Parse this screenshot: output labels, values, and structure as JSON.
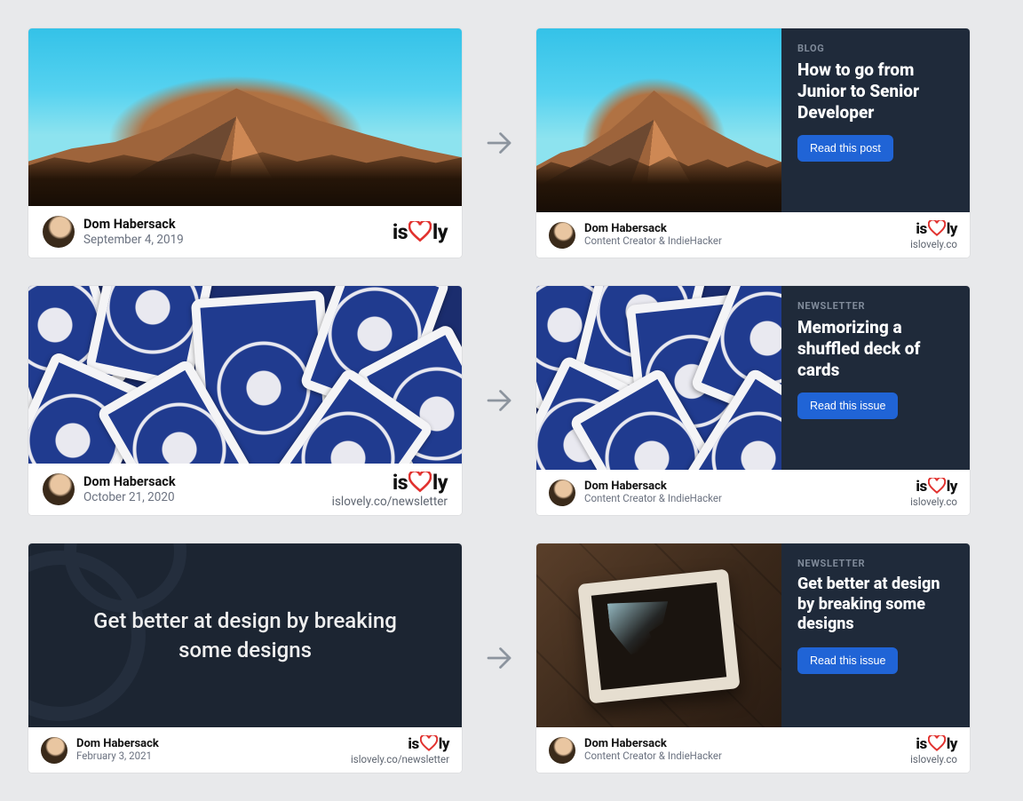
{
  "author": {
    "name": "Dom Habersack",
    "role": "Content Creator & IndieHacker"
  },
  "brand": {
    "prefix": "is",
    "suffix": "ly"
  },
  "site": "islovely.co",
  "rows": [
    {
      "left_sub": "September 4, 2019",
      "left_right_sub": "",
      "eyebrow": "BLOG",
      "title": "How to go from Junior to Senior Developer",
      "button": "Read this post",
      "media": "mountain"
    },
    {
      "left_sub": "October 21, 2020",
      "left_right_sub": "islovely.co/newsletter",
      "eyebrow": "NEWSLETTER",
      "title": "Memorizing a shuffled deck of cards",
      "button": "Read this issue",
      "media": "cards"
    },
    {
      "left_sub": "February 3, 2021",
      "left_right_sub": "islovely.co/newsletter",
      "left_slide_title": "Get better at design by breaking some designs",
      "eyebrow": "NEWSLETTER",
      "title": "Get better at design by breaking some designs",
      "button": "Read this issue",
      "media": "broken"
    }
  ]
}
